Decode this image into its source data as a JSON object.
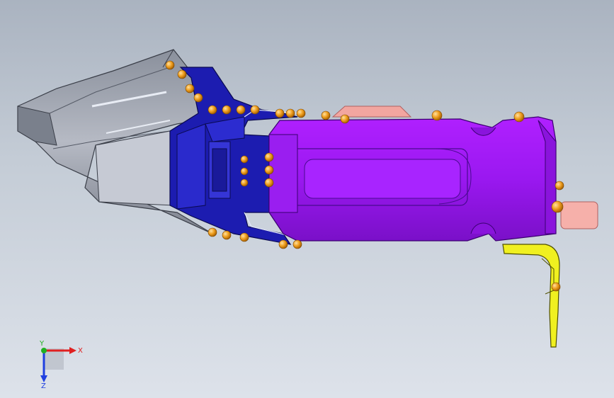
{
  "viewport": {
    "background_top": "#aab3c0",
    "background_bottom": "#dde2ea"
  },
  "model": {
    "parts": [
      {
        "name": "gray-hood-part",
        "color": "#9aa0ad"
      },
      {
        "name": "blue-frame-part",
        "color": "#1a1aa6"
      },
      {
        "name": "purple-bracket-part",
        "color": "#a020f0"
      },
      {
        "name": "yellow-clip-part",
        "color": "#f0f000"
      },
      {
        "name": "pink-tab-part",
        "color": "#f4a0a0"
      }
    ],
    "weld_color": "#f0a020"
  },
  "triad": {
    "x_label": "X",
    "y_label": "Y",
    "z_label": "Z",
    "x_color": "#e02020",
    "y_color": "#20b020",
    "z_color": "#2040e0"
  }
}
